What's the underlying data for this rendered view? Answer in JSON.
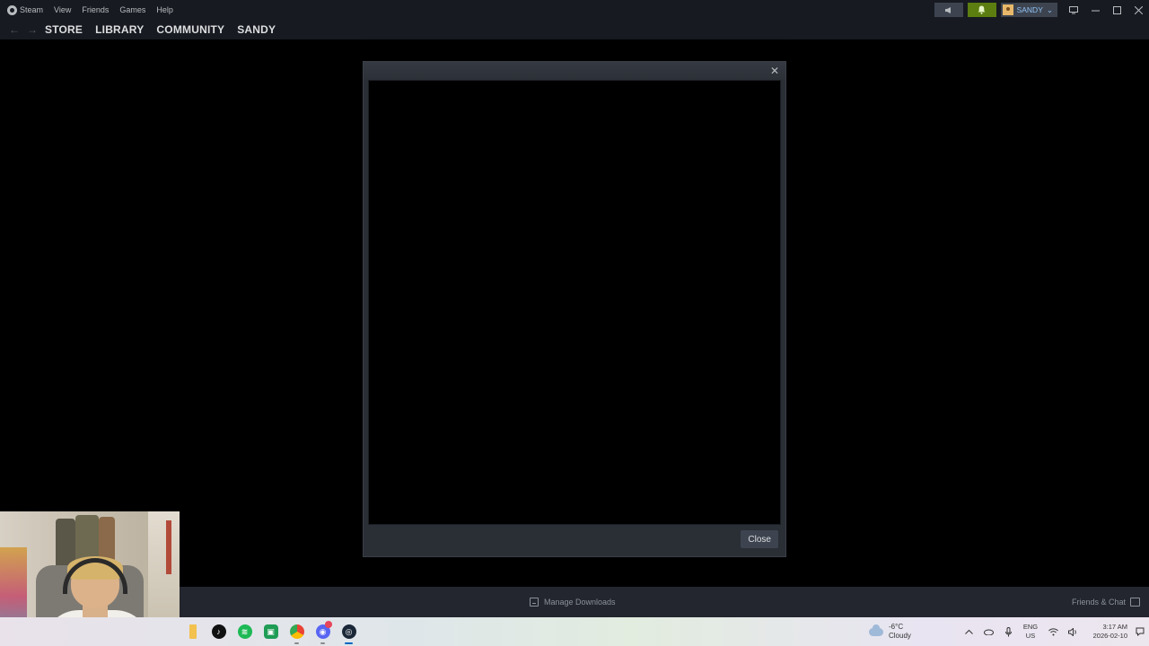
{
  "menu": {
    "steam": "Steam",
    "items": [
      "View",
      "Friends",
      "Games",
      "Help"
    ]
  },
  "user": {
    "name": "SANDY",
    "caret": "⌄"
  },
  "nav": {
    "back_icon": "←",
    "forward_icon": "→",
    "tabs": [
      "STORE",
      "LIBRARY",
      "COMMUNITY",
      "SANDY"
    ]
  },
  "dialog": {
    "close_button_label": "Close",
    "close_icon": "✕"
  },
  "statusbar": {
    "manage_downloads": "Manage Downloads",
    "friends_chat": "Friends & Chat"
  },
  "taskbar": {
    "apps": [
      {
        "name": "folder",
        "glyph": ""
      },
      {
        "name": "tiktok",
        "glyph": "♪"
      },
      {
        "name": "spotify",
        "glyph": "≋"
      },
      {
        "name": "android-studio",
        "glyph": "▣"
      },
      {
        "name": "chrome",
        "glyph": ""
      },
      {
        "name": "discord",
        "glyph": "◉"
      },
      {
        "name": "steam",
        "glyph": "◎"
      }
    ],
    "weather": {
      "temp": "-6°C",
      "condition": "Cloudy"
    },
    "lang": {
      "line1": "ENG",
      "line2": "US"
    },
    "clock": {
      "time": "3:17 AM",
      "date": "2026-02-10"
    }
  },
  "colors": {
    "steam_dark": "#171a21",
    "dialog_bg": "#2a2e35",
    "notify_green": "#5c7e10",
    "user_blue": "#8fc2f5"
  }
}
